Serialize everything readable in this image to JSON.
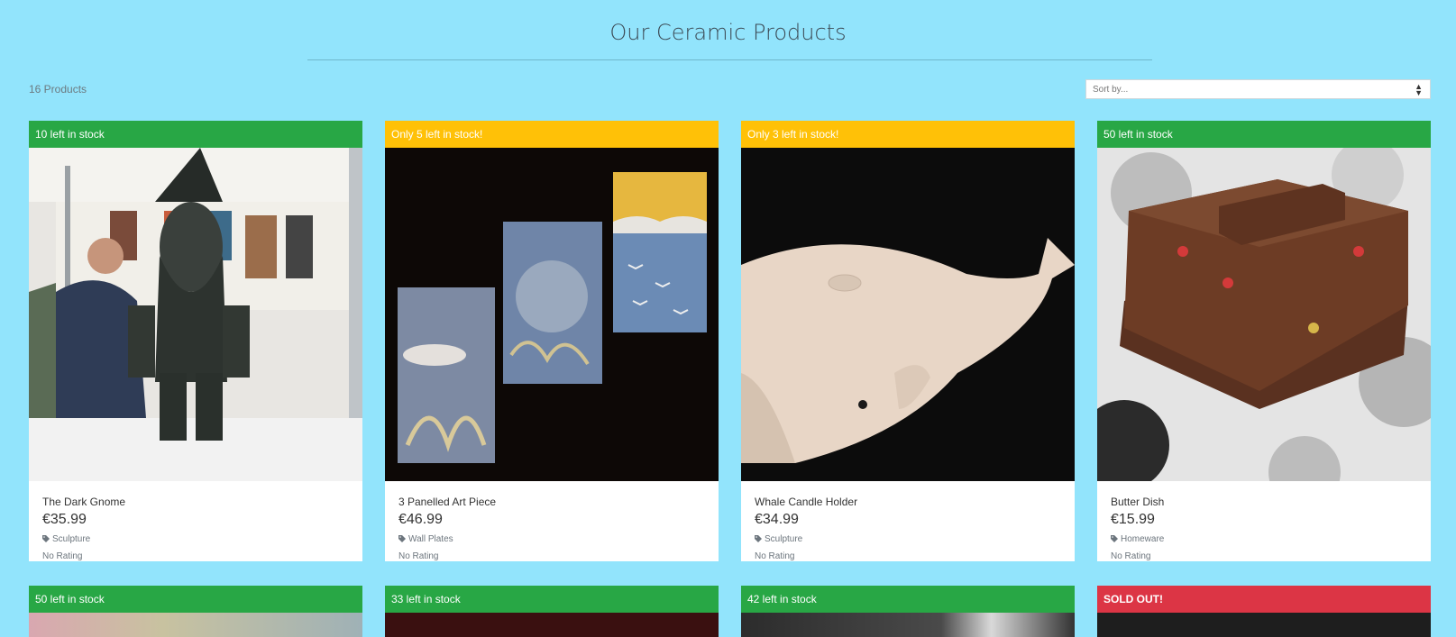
{
  "page": {
    "title": "Our Ceramic Products"
  },
  "toolbar": {
    "count": "16 Products",
    "sort_placeholder": "Sort by..."
  },
  "products": [
    {
      "stock": "10 left in stock",
      "status": "green",
      "name": "The Dark Gnome",
      "price": "€35.99",
      "category": "Sculpture",
      "rating": "No Rating",
      "image": "gnome-photo"
    },
    {
      "stock": "Only 5 left in stock!",
      "status": "yellow",
      "name": "3 Panelled Art Piece",
      "price": "€46.99",
      "category": "Wall Plates",
      "rating": "No Rating",
      "image": "panels-photo"
    },
    {
      "stock": "Only 3 left in stock!",
      "status": "yellow",
      "name": "Whale Candle Holder",
      "price": "€34.99",
      "category": "Sculpture",
      "rating": "No Rating",
      "image": "whale-photo"
    },
    {
      "stock": "50 left in stock",
      "status": "green",
      "name": "Butter Dish",
      "price": "€15.99",
      "category": "Homeware",
      "rating": "No Rating",
      "image": "butter-dish-photo"
    },
    {
      "stock": "50 left in stock",
      "status": "green"
    },
    {
      "stock": "33 left in stock",
      "status": "green"
    },
    {
      "stock": "42 left in stock",
      "status": "green"
    },
    {
      "stock": "SOLD OUT!",
      "status": "red"
    }
  ]
}
